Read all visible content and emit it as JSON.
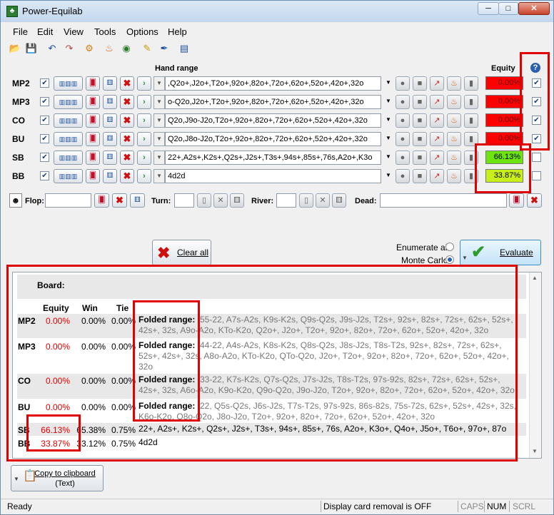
{
  "window": {
    "title": "Power-Equilab",
    "minimize": "─",
    "maximize": "□",
    "close": "✕"
  },
  "menu": [
    "File",
    "Edit",
    "View",
    "Tools",
    "Options",
    "Help"
  ],
  "toolbar_icons": [
    "open-icon",
    "save-icon",
    "undo-icon",
    "redo-icon",
    "settings-icon",
    "fire-icon",
    "globe-icon",
    "pencil-icon",
    "pen-icon",
    "book-icon"
  ],
  "headers": {
    "hand_range": "Hand range",
    "equity": "Equity",
    "help": "?"
  },
  "players": [
    {
      "name": "MP2",
      "range": ",Q2o+,J2o+,T2o+,92o+,82o+,72o+,62o+,52o+,42o+,32o",
      "equity": "0.00%",
      "checked": true
    },
    {
      "name": "MP3",
      "range": "o-Q2o,J2o+,T2o+,92o+,82o+,72o+,62o+,52o+,42o+,32o",
      "equity": "0.00%",
      "checked": true
    },
    {
      "name": "CO",
      "range": "Q2o,J9o-J2o,T2o+,92o+,82o+,72o+,62o+,52o+,42o+,32o",
      "equity": "0.00%",
      "checked": true
    },
    {
      "name": "BU",
      "range": "Q2o,J8o-J2o,T2o+,92o+,82o+,72o+,62o+,52o+,42o+,32o",
      "equity": "0.00%",
      "checked": true
    },
    {
      "name": "SB",
      "range": "22+,A2s+,K2s+,Q2s+,J2s+,T3s+,94s+,85s+,76s,A2o+,K3o",
      "equity": "66.13%",
      "checked": false
    },
    {
      "name": "BB",
      "range": "4d2d",
      "equity": "33.87%",
      "checked": false
    }
  ],
  "board": {
    "flop": "Flop:",
    "turn": "Turn:",
    "river": "River:",
    "dead": "Dead:"
  },
  "actions": {
    "clear_all": "Clear all",
    "enumerate_all": "Enumerate all",
    "monte_carlo": "Monte Carlo",
    "evaluate": "Evaluate"
  },
  "results": {
    "board_label": "Board:",
    "columns": [
      "Equity",
      "Win",
      "Tie"
    ],
    "folded_label": "Folded range:",
    "rows": [
      {
        "name": "MP2",
        "equity": "0.00%",
        "win": "0.00%",
        "tie": "0.00%",
        "folded": true,
        "lines": [
          "55-22, A7s-A2s, K9s-K2s, Q9s-Q2s, J9s-J2s, T2s+, 92s+, 82s+, 72s+, 62s+, 52s+,",
          "42s+, 32s, A9o-A2o, KTo-K2o, Q2o+, J2o+, T2o+, 92o+, 82o+, 72o+, 62o+, 52o+, 42o+, 32o"
        ]
      },
      {
        "name": "MP3",
        "equity": "0.00%",
        "win": "0.00%",
        "tie": "0.00%",
        "folded": true,
        "lines": [
          "44-22, A4s-A2s, K8s-K2s, Q8s-Q2s, J8s-J2s, T8s-T2s, 92s+, 82s+, 72s+, 62s+,",
          "52s+, 42s+, 32s, A8o-A2o, KTo-K2o, QTo-Q2o, J2o+, T2o+, 92o+, 82o+, 72o+, 62o+, 52o+, 42o+,",
          "32o"
        ]
      },
      {
        "name": "CO",
        "equity": "0.00%",
        "win": "0.00%",
        "tie": "0.00%",
        "folded": true,
        "lines": [
          "33-22, K7s-K2s, Q7s-Q2s, J7s-J2s, T8s-T2s, 97s-92s, 82s+, 72s+, 62s+, 52s+,",
          "42s+, 32s, A6o-A2o, K9o-K2o, Q9o-Q2o, J9o-J2o, T2o+, 92o+, 82o+, 72o+, 62o+, 52o+, 42o+, 32o"
        ]
      },
      {
        "name": "BU",
        "equity": "0.00%",
        "win": "0.00%",
        "tie": "0.00%",
        "folded": true,
        "lines": [
          "22, Q5s-Q2s, J6s-J2s, T7s-T2s, 97s-92s, 86s-82s, 75s-72s, 62s+, 52s+, 42s+, 32s,",
          "K6o-K2o, Q8o-Q2o, J8o-J2o, T2o+, 92o+, 82o+, 72o+, 62o+, 52o+, 42o+, 32o"
        ]
      },
      {
        "name": "SB",
        "equity": "66.13%",
        "win": "65.38%",
        "tie": "0.75%",
        "folded": false,
        "lines": [
          "22+, A2s+, K2s+, Q2s+, J2s+, T3s+, 94s+, 85s+, 76s, A2o+, K3o+, Q4o+, J5o+, T6o+, 97o+, 87o"
        ]
      },
      {
        "name": "BB",
        "equity": "33.87%",
        "win": "33.12%",
        "tie": "0.75%",
        "folded": false,
        "lines": [
          "4d2d"
        ]
      }
    ]
  },
  "clipboard": {
    "line1": "Copy to clipboard",
    "line2": "(Text)"
  },
  "status": {
    "ready": "Ready",
    "card_removal": "Display card removal is OFF",
    "caps": "CAPS",
    "num": "NUM",
    "scrl": "SCRL"
  },
  "colors": {
    "equity_zero": "#ff0000",
    "sb_equity": "#6ee40e",
    "bb_equity": "#c9ef1a",
    "highlight_box": "#e00000"
  }
}
